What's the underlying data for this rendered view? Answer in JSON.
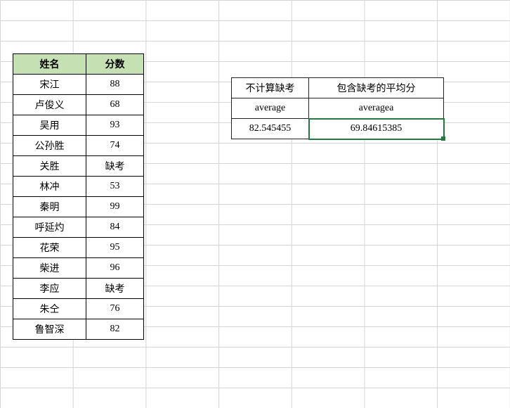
{
  "left_table": {
    "header": {
      "name": "姓名",
      "score": "分数"
    },
    "rows": [
      {
        "name": "宋江",
        "score": "88"
      },
      {
        "name": "卢俊义",
        "score": "68"
      },
      {
        "name": "吴用",
        "score": "93"
      },
      {
        "name": "公孙胜",
        "score": "74"
      },
      {
        "name": "关胜",
        "score": "缺考"
      },
      {
        "name": "林冲",
        "score": "53"
      },
      {
        "name": "秦明",
        "score": "99"
      },
      {
        "name": "呼延灼",
        "score": "84"
      },
      {
        "name": "花荣",
        "score": "95"
      },
      {
        "name": "柴进",
        "score": "96"
      },
      {
        "name": "李应",
        "score": "缺考"
      },
      {
        "name": "朱仝",
        "score": "76"
      },
      {
        "name": "鲁智深",
        "score": "82"
      }
    ]
  },
  "right_table": {
    "header": {
      "c1": "不计算缺考",
      "c2": "包含缺考的平均分"
    },
    "formula": {
      "c1": "average",
      "c2": "averagea"
    },
    "value": {
      "c1": "82.545455",
      "c2": "69.84615385"
    }
  }
}
